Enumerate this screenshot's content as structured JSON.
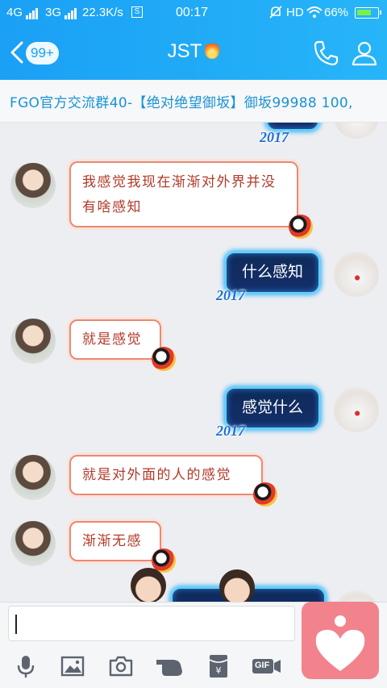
{
  "status_bar": {
    "network_1": "4G",
    "network_2": "3G",
    "speed": "22.3K/s",
    "time": "00:17",
    "hd": "HD",
    "battery": "66%"
  },
  "header": {
    "unread_badge": "99+",
    "title": "JST"
  },
  "banner": {
    "text": "FGO官方交流群40-【绝对绝望御坂】御坂99988 100,"
  },
  "messages": [
    {
      "side": "in",
      "text": "我感觉我现在渐渐对外界并没有啥感知"
    },
    {
      "side": "out",
      "text": "什么感知",
      "tag": "2017"
    },
    {
      "side": "in",
      "text": "就是感觉"
    },
    {
      "side": "out",
      "text": "感觉什么",
      "tag": "2017"
    },
    {
      "side": "in",
      "text": "就是对外面的人的感觉"
    },
    {
      "side": "in",
      "text": "渐渐无感"
    }
  ],
  "partial_tag": "2017",
  "input": {
    "value": ""
  },
  "toolbar": {
    "items": [
      "mic-icon",
      "image-icon",
      "camera-icon",
      "hand-icon",
      "red-packet-icon",
      "gif-icon"
    ],
    "gif_label": "GIF"
  },
  "colors": {
    "header_blue": "#1aa0f5",
    "bubble_in_border": "#e88a74",
    "bubble_in_text": "#b23a2a",
    "bubble_out_bg": "#0e2a5a",
    "bubble_out_glow": "#5ad2ff",
    "heart_button": "#f2838d"
  }
}
